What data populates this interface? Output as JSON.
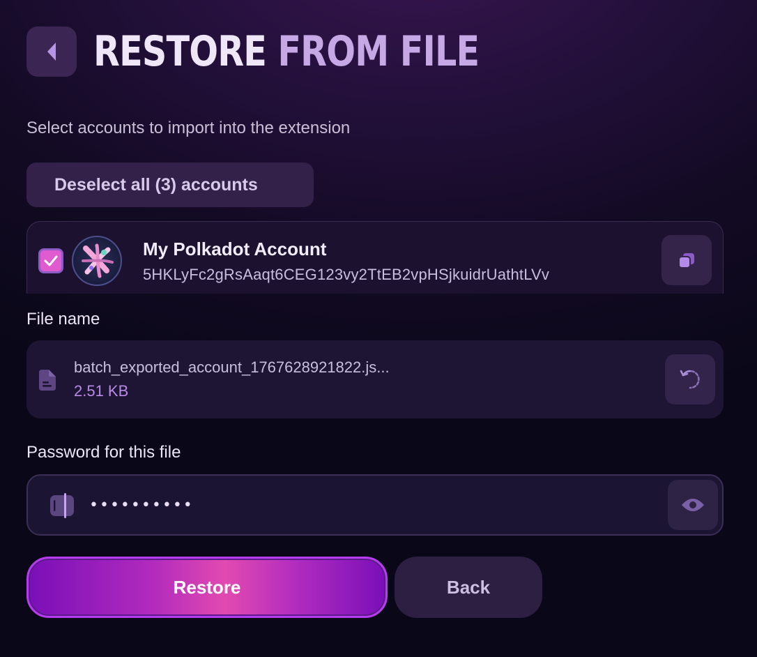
{
  "header": {
    "title_word1": "RESTORE",
    "title_word2": "FROM FILE",
    "back_icon": "chevron-left-icon"
  },
  "subtitle": "Select accounts to import into the extension",
  "deselect_button": "Deselect all (3) accounts",
  "accounts": [
    {
      "name": "My Polkadot Account",
      "address": "5HKLyFc2gRsAaqt6CEG123vy2TtEB2vpHSjkuidrUathtLVv",
      "checked": true,
      "avatar_icon": "polkadot-identicon",
      "copy_icon": "copy-icon"
    }
  ],
  "file": {
    "label": "File name",
    "name": "batch_exported_account_1767628921822.js...",
    "size": "2.51 KB",
    "file_icon": "file-icon",
    "reset_icon": "reset-icon"
  },
  "password": {
    "label": "Password for this file",
    "value": "••••••••••",
    "lock_icon": "password-icon",
    "toggle_icon": "eye-icon"
  },
  "actions": {
    "restore": "Restore",
    "back": "Back"
  },
  "colors": {
    "accent": "#b73cef",
    "accent_pink": "#e24ab0",
    "checkbox": "#e05ad0",
    "file_size": "#b98ae8"
  }
}
